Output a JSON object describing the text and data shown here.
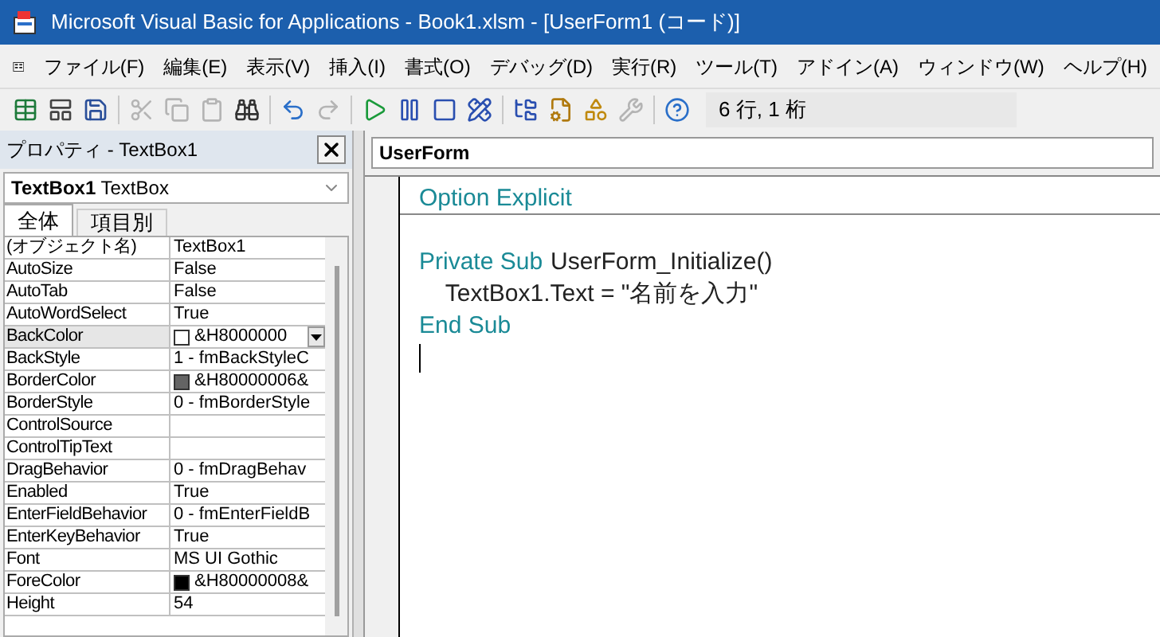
{
  "window": {
    "title": "Microsoft Visual Basic for Applications - Book1.xlsm - [UserForm1 (コード)]"
  },
  "menu": [
    "ファイル(F)",
    "編集(E)",
    "表示(V)",
    "挿入(I)",
    "書式(O)",
    "デバッグ(D)",
    "実行(R)",
    "ツール(T)",
    "アドイン(A)",
    "ウィンドウ(W)",
    "ヘルプ(H)"
  ],
  "toolbar": {
    "buttons": [
      {
        "kind": "excel",
        "disabled": false
      },
      {
        "kind": "userform",
        "disabled": false
      },
      {
        "kind": "save",
        "disabled": false
      },
      {
        "kind": "cut",
        "disabled": true
      },
      {
        "kind": "copy",
        "disabled": true
      },
      {
        "kind": "paste",
        "disabled": true
      },
      {
        "kind": "find",
        "disabled": false
      },
      {
        "kind": "undo",
        "disabled": false
      },
      {
        "kind": "redo",
        "disabled": true
      },
      {
        "kind": "run",
        "disabled": false
      },
      {
        "kind": "pause",
        "disabled": false
      },
      {
        "kind": "stop",
        "disabled": false
      },
      {
        "kind": "design",
        "disabled": false
      },
      {
        "kind": "project",
        "disabled": false
      },
      {
        "kind": "properties",
        "disabled": false
      },
      {
        "kind": "browser",
        "disabled": false
      },
      {
        "kind": "toolbox",
        "disabled": true
      },
      {
        "kind": "help",
        "disabled": false
      }
    ],
    "position": "6 行, 1 桁"
  },
  "properties": {
    "title": "プロパティ - TextBox1",
    "object": "**TextBox1** TextBox",
    "tabs": [
      {
        "label": "全体",
        "selected": true
      },
      {
        "label": "項目別",
        "selected": false
      }
    ],
    "rows": [
      {
        "name": "(オブジェクト名)",
        "value": "TextBox1",
        "selected": false
      },
      {
        "name": "AutoSize",
        "value": "False",
        "selected": false
      },
      {
        "name": "AutoTab",
        "value": "False",
        "selected": false
      },
      {
        "name": "AutoWordSelect",
        "value": "True",
        "selected": false
      },
      {
        "name": "BackColor",
        "value": "&H8000000",
        "color": "#ffffff",
        "selected": true
      },
      {
        "name": "BackStyle",
        "value": "1 - fmBackStyleC",
        "selected": false
      },
      {
        "name": "BorderColor",
        "value": "&H80000006&",
        "color": "#646464",
        "selected": false
      },
      {
        "name": "BorderStyle",
        "value": "0 - fmBorderStyle",
        "selected": false
      },
      {
        "name": "ControlSource",
        "value": "",
        "selected": false
      },
      {
        "name": "ControlTipText",
        "value": "",
        "selected": false
      },
      {
        "name": "DragBehavior",
        "value": "0 - fmDragBehav",
        "selected": false
      },
      {
        "name": "Enabled",
        "value": "True",
        "selected": false
      },
      {
        "name": "EnterFieldBehavior",
        "value": "0 - fmEnterFieldB",
        "selected": false
      },
      {
        "name": "EnterKeyBehavior",
        "value": "True",
        "selected": false
      },
      {
        "name": "Font",
        "value": "MS UI Gothic",
        "selected": false
      },
      {
        "name": "ForeColor",
        "value": "&H80000008&",
        "color": "#000000",
        "selected": false
      },
      {
        "name": "Height",
        "value": "54",
        "selected": false
      }
    ]
  },
  "code": {
    "object": "UserForm",
    "lines": [
      {
        "tokens": [
          {
            "kind": "keyword",
            "text": "Option Explicit"
          }
        ],
        "separator": true
      },
      {
        "separator": false
      },
      {
        "tokens": [
          {
            "kind": "keyword",
            "text": "Private Sub"
          },
          {
            "kind": "plain",
            "text": "UserForm_Initialize()"
          }
        ],
        "separator": false
      },
      {
        "tokens": [
          {
            "kind": "plain",
            "text": "    TextBox1.Text = \"名前を入力\""
          }
        ],
        "separator": false
      },
      {
        "tokens": [
          {
            "kind": "keyword",
            "text": "End Sub"
          }
        ],
        "separator": false
      },
      {
        "separator": false,
        "cursor": true
      }
    ]
  }
}
